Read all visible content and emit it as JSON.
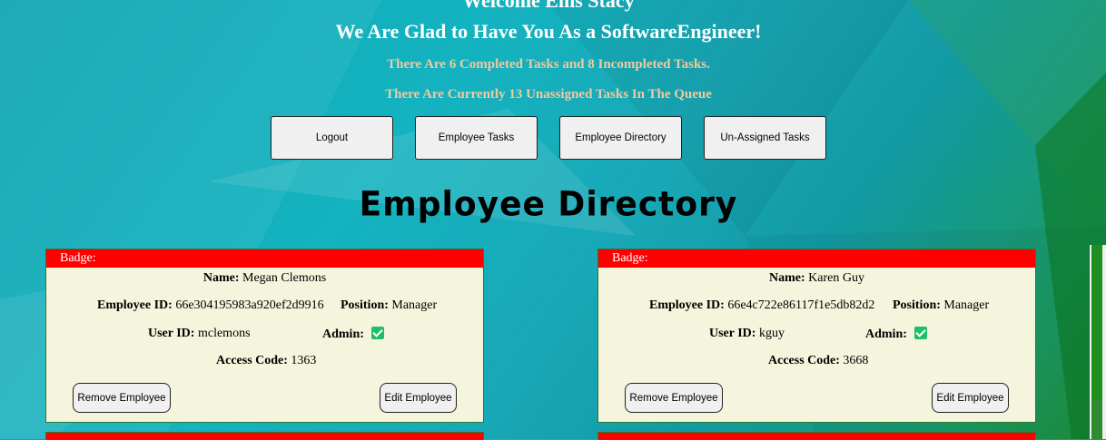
{
  "header": {
    "welcome": "Welcome Ellis Stacy",
    "glad": "We Are Glad to Have You As a SoftwareEngineer!",
    "task_stats": "There Are 6 Completed Tasks and 8 Incompleted Tasks.",
    "queue_stats": "There Are Currently 13 Unassigned Tasks In The Queue"
  },
  "nav": {
    "logout": "Logout",
    "employee_tasks": "Employee Tasks",
    "employee_directory": "Employee Directory",
    "unassigned_tasks": "Un-Assigned Tasks"
  },
  "directory_title": "Employee Directory",
  "labels": {
    "badge": "Badge:",
    "name": "Name:",
    "employee_id": "Employee ID:",
    "position": "Position:",
    "user_id": "User ID:",
    "admin": "Admin:",
    "access_code": "Access Code:",
    "remove": "Remove Employee",
    "edit": "Edit Employee"
  },
  "employees": [
    {
      "name": "Megan Clemons",
      "employee_id": "66e304195983a920ef2d9916",
      "position": "Manager",
      "user_id": "mclemons",
      "admin": true,
      "access_code": "1363"
    },
    {
      "name": "Karen Guy",
      "employee_id": "66e4c722e86117f1e5db82d2",
      "position": "Manager",
      "user_id": "kguy",
      "admin": true,
      "access_code": "3668"
    }
  ],
  "colors": {
    "badge": "#ff0000",
    "card_bg": "#f5f4dc",
    "check": "#1fbf6a",
    "stat_text": "#f0c9a0"
  }
}
